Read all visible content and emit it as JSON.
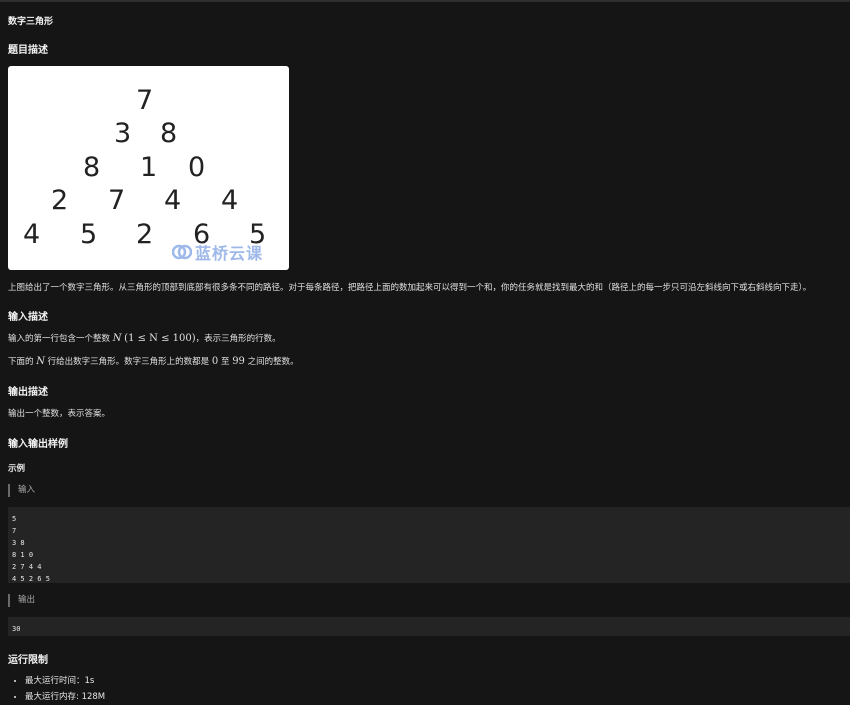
{
  "page_title": "数字三角形",
  "sections": {
    "desc_heading": "题目描述",
    "input_heading": "输入描述",
    "output_heading": "输出描述",
    "sample_heading": "输入输出样例",
    "limits_heading": "运行限制"
  },
  "figure": {
    "rows": [
      [
        "7"
      ],
      [
        "3",
        "8"
      ],
      [
        "8",
        "1",
        "0"
      ],
      [
        "2",
        "7",
        "4",
        "4"
      ],
      [
        "4",
        "5",
        "2",
        "6",
        "5"
      ]
    ],
    "watermark": "蓝桥云课"
  },
  "description_text": "上图给出了一个数字三角形。从三角形的顶部到底部有很多条不同的路径。对于每条路径，把路径上面的数加起来可以得到一个和，你的任务就是找到最大的和（路径上的每一步只可沿左斜线向下或右斜线向下走）。",
  "input_desc": {
    "line1_pre": "输入的第一行包含一个整数",
    "line1_var": "N",
    "line1_cond": "(1 ≤ N ≤ 100)",
    "line1_post": "，表示三角形的行数。",
    "line2_pre": "下面的",
    "line2_var": "N",
    "line2_mid": "行给出数字三角形。数字三角形上的数都是",
    "line2_zero": "0",
    "line2_to": "至",
    "line2_max": "99",
    "line2_post": "之间的整数。"
  },
  "output_desc": "输出一个整数，表示答案。",
  "example": {
    "label": "示例",
    "input_label": "输入",
    "input_code": "5\n7\n3 8\n8 1 0\n2 7 4 4\n4 5 2 6 5",
    "output_label": "输出",
    "output_code": "30"
  },
  "limits": [
    "最大运行时间：1s",
    "最大运行内存: 128M"
  ]
}
